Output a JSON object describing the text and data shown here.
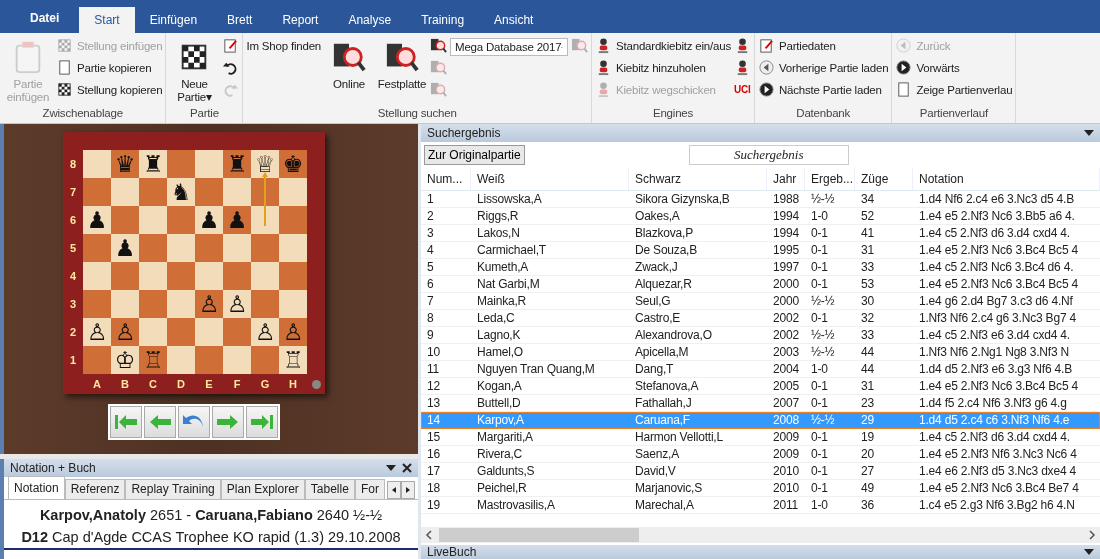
{
  "ribbon_tabs": [
    {
      "label": "Datei",
      "kind": "menu",
      "selected": false
    },
    {
      "label": "Start",
      "kind": "tab",
      "selected": true
    },
    {
      "label": "Einfügen",
      "kind": "tab",
      "selected": false
    },
    {
      "label": "Brett",
      "kind": "tab",
      "selected": false
    },
    {
      "label": "Report",
      "kind": "tab",
      "selected": false
    },
    {
      "label": "Analyse",
      "kind": "tab",
      "selected": false
    },
    {
      "label": "Training",
      "kind": "tab",
      "selected": false
    },
    {
      "label": "Ansicht",
      "kind": "tab",
      "selected": false
    }
  ],
  "ribbon_groups": [
    {
      "label": "Zwischenablage",
      "columns": [
        [
          {
            "kind": "large",
            "label": "Partie einfügen",
            "disabled": true
          }
        ],
        [
          {
            "kind": "small",
            "label": "Stellung einfügen",
            "disabled": true
          },
          {
            "kind": "small",
            "label": "Partie kopieren",
            "disabled": false
          },
          {
            "kind": "small",
            "label": "Stellung kopieren",
            "disabled": false
          }
        ]
      ]
    },
    {
      "label": "Partie",
      "columns": [
        [
          {
            "kind": "large",
            "label": "Neue Partie",
            "caret": "▾",
            "disabled": false
          }
        ],
        [
          {
            "kind": "icon",
            "disabled": false
          },
          {
            "kind": "icon",
            "disabled": false
          },
          {
            "kind": "icon",
            "disabled": true
          }
        ]
      ]
    },
    {
      "label": "Stellung suchen",
      "columns": [
        [
          {
            "kind": "text",
            "label": "Im Shop finden",
            "disabled": false
          }
        ],
        [
          {
            "kind": "large",
            "label": "Online",
            "disabled": false
          }
        ],
        [
          {
            "kind": "large",
            "label": "Festplatte",
            "disabled": false
          }
        ],
        [
          {
            "kind": "icon",
            "disabled": false
          },
          {
            "kind": "icon",
            "disabled": true
          },
          {
            "kind": "icon",
            "disabled": true
          }
        ],
        [
          {
            "kind": "combo",
            "value": "Mega Database 2017",
            "disabled": false
          }
        ],
        [
          {
            "kind": "icon",
            "disabled": true
          }
        ]
      ]
    },
    {
      "label": "Engines",
      "columns": [
        [
          {
            "kind": "small",
            "label": "Standardkiebitz ein/aus",
            "disabled": false
          },
          {
            "kind": "small",
            "label": "Kiebitz hinzuholen",
            "disabled": false
          },
          {
            "kind": "small",
            "label": "Kiebitz wegschicken",
            "disabled": true
          }
        ],
        [
          {
            "kind": "icon",
            "disabled": false
          },
          {
            "kind": "icon",
            "disabled": false
          },
          {
            "kind": "badge",
            "label": "UCI",
            "disabled": false
          }
        ]
      ]
    },
    {
      "label": "Datenbank",
      "columns": [
        [
          {
            "kind": "small",
            "label": "Partiedaten",
            "disabled": false
          },
          {
            "kind": "small",
            "label": "Vorherige Partie laden",
            "disabled": false
          },
          {
            "kind": "small",
            "label": "Nächste Partie laden",
            "disabled": false
          }
        ]
      ]
    },
    {
      "label": "Partienverlauf",
      "columns": [
        [
          {
            "kind": "small",
            "label": "Zurück",
            "disabled": true
          },
          {
            "kind": "small",
            "label": "Vorwärts",
            "disabled": false
          },
          {
            "kind": "small",
            "label": "Zeige Partienverlau",
            "disabled": false
          }
        ]
      ]
    }
  ],
  "board": {
    "ranks": [
      "8",
      "7",
      "6",
      "5",
      "4",
      "3",
      "2",
      "1"
    ],
    "files": [
      "A",
      "B",
      "C",
      "D",
      "E",
      "F",
      "G",
      "H"
    ],
    "pieces": [
      "♛",
      "♜",
      "♜",
      "♕",
      "♚",
      "♞",
      "♟",
      "♟",
      "♟",
      "♟",
      "♙",
      "♙",
      "♙",
      "♙",
      "♙",
      "♙",
      "♔",
      "♖",
      "♖"
    ]
  },
  "notation_panel": {
    "title": "Notation + Buch",
    "tabs": [
      {
        "label": "Notation",
        "selected": true
      },
      {
        "label": "Referenz",
        "selected": false
      },
      {
        "label": "Replay Training",
        "selected": false
      },
      {
        "label": "Plan Explorer",
        "selected": false
      },
      {
        "label": "Tabelle",
        "selected": false
      },
      {
        "label": "For",
        "selected": false
      }
    ],
    "header_line": "**Karpov,Anatoly** 2651 - **Caruana,Fabiano** 2640  ½-½",
    "event_line": "**D12** Cap d'Agde CCAS Trophee KO rapid (1.3) 29.10.2008"
  },
  "search_panel": {
    "title": "Suchergebnis",
    "button": "Zur Originalpartie",
    "caption": "Suchergebnis",
    "columns": [
      "Num...",
      "Weiß",
      "Schwarz",
      "Jahr",
      "Ergeb...",
      "Züge",
      "Notation"
    ],
    "rows": [
      {
        "cells": [
          "1",
          "Lissowska,A",
          "Sikora Gizynska,B",
          "1988",
          "½-½",
          "34",
          "1.d4 Nf6 2.c4 e6 3.Nc3 d5 4.B"
        ],
        "selected": false
      },
      {
        "cells": [
          "2",
          "Riggs,R",
          "Oakes,A",
          "1994",
          "1-0",
          "52",
          "1.e4 e5 2.Nf3 Nc6 3.Bb5 a6 4."
        ],
        "selected": false
      },
      {
        "cells": [
          "3",
          "Lakos,N",
          "Blazkova,P",
          "1994",
          "0-1",
          "41",
          "1.e4 c5 2.Nf3 d6 3.d4 cxd4 4."
        ],
        "selected": false
      },
      {
        "cells": [
          "4",
          "Carmichael,T",
          "De Souza,B",
          "1995",
          "0-1",
          "31",
          "1.e4 e5 2.Nf3 Nc6 3.Bc4 Bc5 4"
        ],
        "selected": false
      },
      {
        "cells": [
          "5",
          "Kumeth,A",
          "Zwack,J",
          "1997",
          "0-1",
          "33",
          "1.e4 c5 2.Nf3 Nc6 3.Bc4 d6 4."
        ],
        "selected": false
      },
      {
        "cells": [
          "6",
          "Nat Garbi,M",
          "Alquezar,R",
          "2000",
          "0-1",
          "53",
          "1.e4 e5 2.Nf3 Nc6 3.Bc4 Bc5 4"
        ],
        "selected": false
      },
      {
        "cells": [
          "7",
          "Mainka,R",
          "Seul,G",
          "2000",
          "½-½",
          "30",
          "1.e4 g6 2.d4 Bg7 3.c3 d6 4.Nf"
        ],
        "selected": false
      },
      {
        "cells": [
          "8",
          "Leda,C",
          "Castro,E",
          "2002",
          "0-1",
          "32",
          "1.Nf3 Nf6 2.c4 g6 3.Nc3 Bg7 4"
        ],
        "selected": false
      },
      {
        "cells": [
          "9",
          "Lagno,K",
          "Alexandrova,O",
          "2002",
          "½-½",
          "33",
          "1.e4 c5 2.Nf3 e6 3.d4 cxd4 4."
        ],
        "selected": false
      },
      {
        "cells": [
          "10",
          "Hamel,O",
          "Apicella,M",
          "2003",
          "½-½",
          "44",
          "1.Nf3 Nf6 2.Ng1 Ng8 3.Nf3 N"
        ],
        "selected": false
      },
      {
        "cells": [
          "11",
          "Nguyen Tran Quang,M",
          "Dang,T",
          "2004",
          "1-0",
          "44",
          "1.d4 d5 2.Nf3 e6 3.g3 Nf6 4.B"
        ],
        "selected": false
      },
      {
        "cells": [
          "12",
          "Kogan,A",
          "Stefanova,A",
          "2005",
          "0-1",
          "31",
          "1.e4 e5 2.Nf3 Nc6 3.Bc4 Bc5 4"
        ],
        "selected": false
      },
      {
        "cells": [
          "13",
          "Buttell,D",
          "Fathallah,J",
          "2007",
          "0-1",
          "23",
          "1.d4 f5 2.c4 Nf6 3.Nf3 g6 4.g"
        ],
        "selected": false
      },
      {
        "cells": [
          "14",
          "Karpov,A",
          "Caruana,F",
          "2008",
          "½-½",
          "29",
          "1.d4 d5 2.c4 c6 3.Nf3 Nf6 4.e"
        ],
        "selected": true
      },
      {
        "cells": [
          "15",
          "Margariti,A",
          "Harmon Vellotti,L",
          "2009",
          "0-1",
          "19",
          "1.e4 c5 2.Nf3 d6 3.d4 cxd4 4."
        ],
        "selected": false
      },
      {
        "cells": [
          "16",
          "Rivera,C",
          "Saenz,A",
          "2009",
          "0-1",
          "20",
          "1.e4 e5 2.Nf3 Nf6 3.Nc3 Nc6 4"
        ],
        "selected": false
      },
      {
        "cells": [
          "17",
          "Galdunts,S",
          "David,V",
          "2010",
          "0-1",
          "27",
          "1.e4 e6 2.Nf3 d5 3.Nc3 dxe4 4"
        ],
        "selected": false
      },
      {
        "cells": [
          "18",
          "Peichel,R",
          "Marjanovic,S",
          "2010",
          "0-1",
          "49",
          "1.e4 e5 2.Nf3 Nc6 3.Bc4 Be7 4"
        ],
        "selected": false
      },
      {
        "cells": [
          "19",
          "Mastrovasilis,A",
          "Marechal,A",
          "2011",
          "1-0",
          "36",
          "1.c4 e5 2.g3 Nf6 3.Bg2 h6 4.N"
        ],
        "selected": false
      }
    ]
  },
  "livebuch_panel": {
    "title": "LiveBuch"
  }
}
